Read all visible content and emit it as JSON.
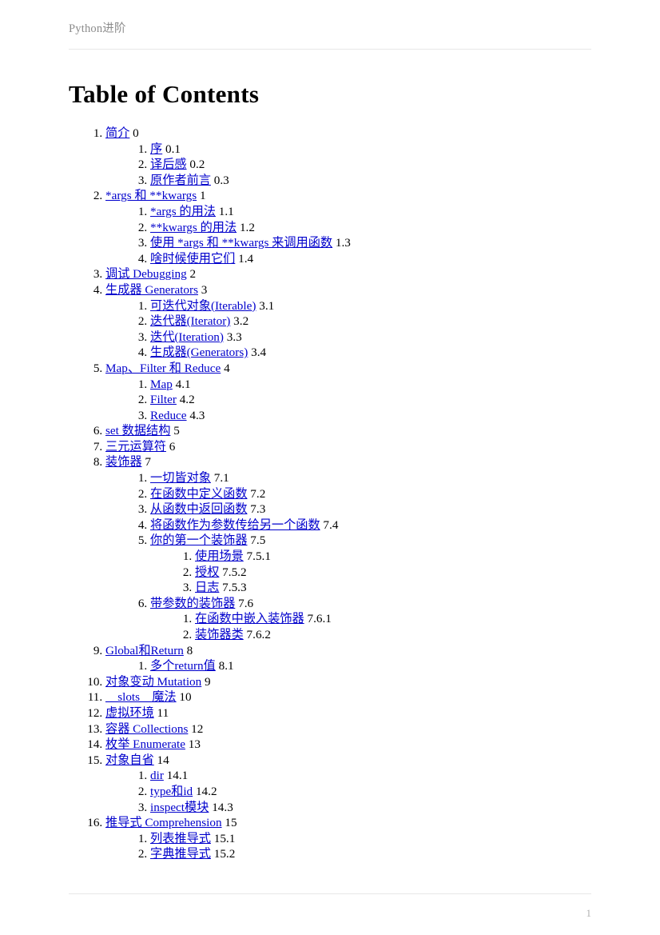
{
  "header": {
    "running_title": "Python进阶"
  },
  "footer": {
    "page_number": "1"
  },
  "title": "Table of Contents",
  "toc": {
    "items": [
      {
        "label": "简介",
        "number": "0",
        "children": [
          {
            "label": "序",
            "number": "0.1"
          },
          {
            "label": "译后感",
            "number": "0.2"
          },
          {
            "label": "原作者前言",
            "number": "0.3"
          }
        ]
      },
      {
        "label": "*args 和 **kwargs",
        "number": "1",
        "children": [
          {
            "label": "*args 的用法",
            "number": "1.1"
          },
          {
            "label": "**kwargs 的用法",
            "number": "1.2"
          },
          {
            "label": "使用 *args 和 **kwargs 来调用函数",
            "number": "1.3"
          },
          {
            "label": "啥时候使用它们",
            "number": "1.4"
          }
        ]
      },
      {
        "label": "调试 Debugging",
        "number": "2",
        "children": []
      },
      {
        "label": "生成器 Generators",
        "number": "3",
        "children": [
          {
            "label": "可迭代对象(Iterable)",
            "number": "3.1"
          },
          {
            "label": "迭代器(Iterator)",
            "number": "3.2"
          },
          {
            "label": "迭代(Iteration)",
            "number": "3.3"
          },
          {
            "label": "生成器(Generators)",
            "number": "3.4"
          }
        ]
      },
      {
        "label": "Map、Filter 和 Reduce",
        "number": "4",
        "children": [
          {
            "label": "Map",
            "number": "4.1"
          },
          {
            "label": "Filter",
            "number": "4.2"
          },
          {
            "label": "Reduce",
            "number": "4.3"
          }
        ]
      },
      {
        "label": "set 数据结构",
        "number": "5",
        "children": []
      },
      {
        "label": "三元运算符",
        "number": "6",
        "children": []
      },
      {
        "label": "装饰器",
        "number": "7",
        "children": [
          {
            "label": "一切皆对象",
            "number": "7.1"
          },
          {
            "label": "在函数中定义函数",
            "number": "7.2"
          },
          {
            "label": "从函数中返回函数",
            "number": "7.3"
          },
          {
            "label": "将函数作为参数传给另一个函数",
            "number": "7.4"
          },
          {
            "label": "你的第一个装饰器",
            "number": "7.5",
            "children": [
              {
                "label": "使用场景",
                "number": "7.5.1"
              },
              {
                "label": "授权",
                "number": "7.5.2"
              },
              {
                "label": "日志",
                "number": "7.5.3"
              }
            ]
          },
          {
            "label": "带参数的装饰器",
            "number": "7.6",
            "children": [
              {
                "label": "在函数中嵌入装饰器",
                "number": "7.6.1"
              },
              {
                "label": "装饰器类",
                "number": "7.6.2"
              }
            ]
          }
        ]
      },
      {
        "label": "Global和Return",
        "number": "8",
        "children": [
          {
            "label": "多个return值",
            "number": "8.1"
          }
        ]
      },
      {
        "label": "对象变动 Mutation",
        "number": "9",
        "children": []
      },
      {
        "label": "__slots__魔法",
        "number": "10",
        "children": []
      },
      {
        "label": "虚拟环境",
        "number": "11",
        "children": []
      },
      {
        "label": "容器 Collections",
        "number": "12",
        "children": []
      },
      {
        "label": "枚举 Enumerate",
        "number": "13",
        "children": []
      },
      {
        "label": "对象自省",
        "number": "14",
        "children": [
          {
            "label": "dir",
            "number": "14.1"
          },
          {
            "label": "type和id",
            "number": "14.2"
          },
          {
            "label": "inspect模块",
            "number": "14.3"
          }
        ]
      },
      {
        "label": "推导式 Comprehension",
        "number": "15",
        "children": [
          {
            "label": "列表推导式",
            "number": "15.1"
          },
          {
            "label": "字典推导式",
            "number": "15.2"
          }
        ]
      }
    ]
  },
  "colors": {
    "link": "#0000cc",
    "text": "#000000",
    "header_text": "#8c8c8c",
    "rule": "#e8e8e8",
    "page_number": "#b0b0b0"
  }
}
